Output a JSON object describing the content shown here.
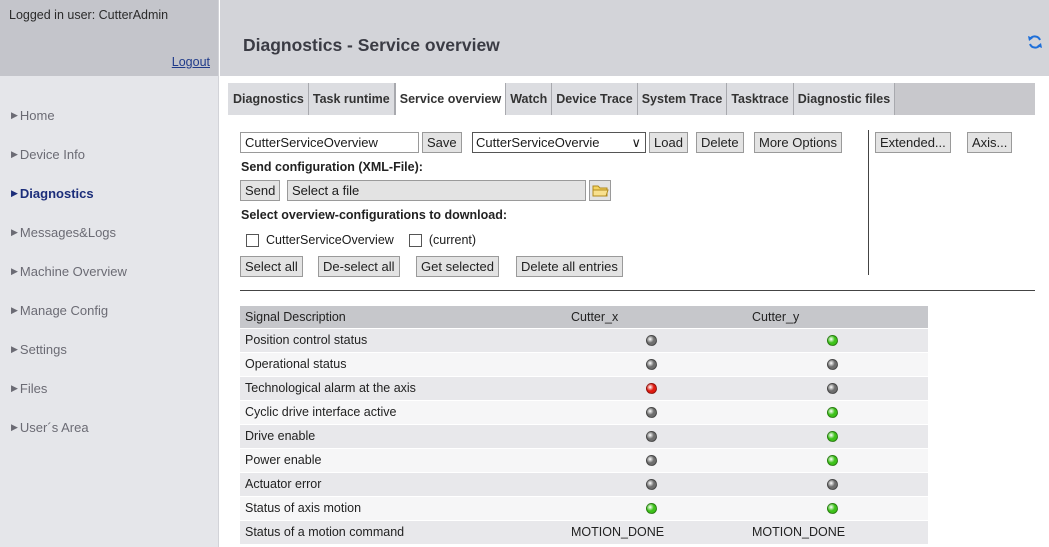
{
  "user": {
    "logged_in_label": "Logged in user: CutterAdmin",
    "logout": "Logout"
  },
  "nav": {
    "items": [
      {
        "label": "Home",
        "active": false
      },
      {
        "label": "Device Info",
        "active": false
      },
      {
        "label": "Diagnostics",
        "active": true
      },
      {
        "label": "Messages&Logs",
        "active": false
      },
      {
        "label": "Machine Overview",
        "active": false
      },
      {
        "label": "Manage Config",
        "active": false
      },
      {
        "label": "Settings",
        "active": false
      },
      {
        "label": "Files",
        "active": false
      },
      {
        "label": "User´s Area",
        "active": false
      }
    ]
  },
  "header": {
    "title": "Diagnostics - Service overview",
    "refresh_icon": "refresh-icon",
    "accent": "#1e6fd9"
  },
  "tabs": [
    {
      "label": "Diagnostics",
      "active": false
    },
    {
      "label": "Task runtime",
      "active": false
    },
    {
      "label": "Service overview",
      "active": true
    },
    {
      "label": "Watch",
      "active": false
    },
    {
      "label": "Device Trace",
      "active": false
    },
    {
      "label": "System Trace",
      "active": false
    },
    {
      "label": "Tasktrace",
      "active": false
    },
    {
      "label": "Diagnostic files",
      "active": false
    }
  ],
  "config": {
    "name_value": "CutterServiceOverview",
    "save": "Save",
    "select_value": "CutterServiceOvervie",
    "load": "Load",
    "delete": "Delete",
    "more_options": "More Options",
    "extended": "Extended...",
    "axis": "Axis..."
  },
  "send": {
    "heading": "Send configuration (XML-File):",
    "send_button": "Send",
    "file_placeholder": "Select a file",
    "folder_icon": "folder-icon"
  },
  "download": {
    "heading": "Select overview-configurations to download:",
    "options": [
      {
        "label": "CutterServiceOverview",
        "checked": false
      },
      {
        "label": "(current)",
        "checked": false
      }
    ],
    "select_all": "Select all",
    "deselect_all": "De-select all",
    "get_selected": "Get selected",
    "delete_all": "Delete all entries"
  },
  "status_colors": {
    "green": "#3ec21a",
    "gray": "#6e6e6e",
    "red": "#e01a10"
  },
  "table": {
    "columns": [
      "Signal Description",
      "Cutter_x",
      "Cutter_y"
    ],
    "rows": [
      {
        "signal": "Position control status",
        "x": "gray",
        "y": "green"
      },
      {
        "signal": "Operational status",
        "x": "gray",
        "y": "gray"
      },
      {
        "signal": "Technological alarm at the axis",
        "x": "red",
        "y": "gray"
      },
      {
        "signal": "Cyclic drive interface active",
        "x": "gray",
        "y": "green"
      },
      {
        "signal": "Drive enable",
        "x": "gray",
        "y": "green"
      },
      {
        "signal": "Power enable",
        "x": "gray",
        "y": "green"
      },
      {
        "signal": "Actuator error",
        "x": "gray",
        "y": "gray"
      },
      {
        "signal": "Status of axis motion",
        "x": "green",
        "y": "green"
      },
      {
        "signal": "Status of a motion command",
        "x_text": "MOTION_DONE",
        "y_text": "MOTION_DONE"
      }
    ]
  }
}
